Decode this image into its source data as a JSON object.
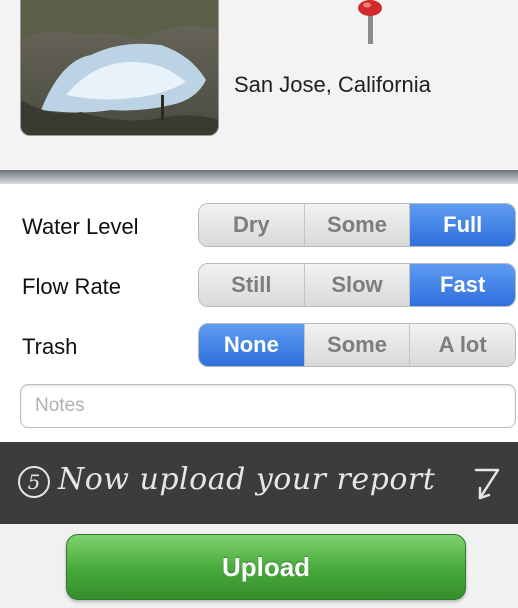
{
  "location": {
    "photo_icon": "landscape-photo",
    "pin_icon": "map-pin-icon",
    "label": "San Jose, California"
  },
  "form": {
    "water_level": {
      "label": "Water Level",
      "options": [
        "Dry",
        "Some",
        "Full"
      ],
      "selected": "Full"
    },
    "flow_rate": {
      "label": "Flow Rate",
      "options": [
        "Still",
        "Slow",
        "Fast"
      ],
      "selected": "Fast"
    },
    "trash": {
      "label": "Trash",
      "options": [
        "None",
        "Some",
        "A lot"
      ],
      "selected": "None"
    },
    "notes": {
      "placeholder": "Notes",
      "value": ""
    }
  },
  "banner": {
    "step_number": "5",
    "text": "Now upload your report",
    "arrow_icon": "arrow-down-icon"
  },
  "upload": {
    "label": "Upload"
  },
  "colors": {
    "selected_segment": "#3b7ee6",
    "upload_green": "#46a83a",
    "banner_bg": "#3c3c3c"
  }
}
